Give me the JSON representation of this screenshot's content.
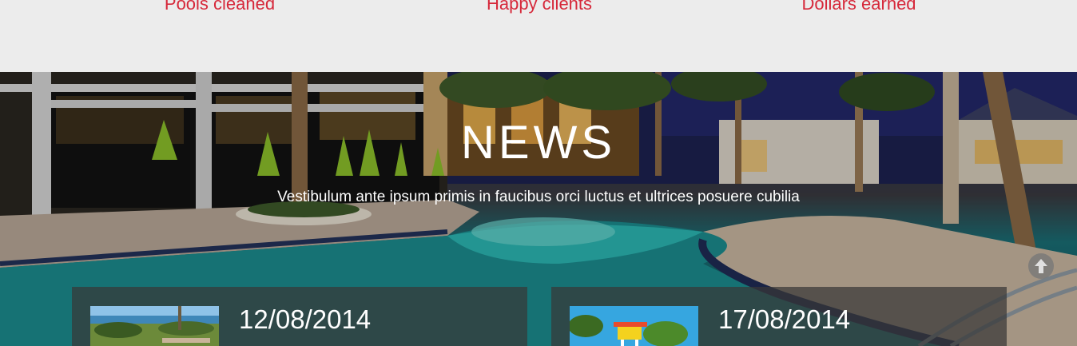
{
  "stats": [
    {
      "label": "Pools cleaned"
    },
    {
      "label": "Happy clients"
    },
    {
      "label": "Dollars earned"
    }
  ],
  "news": {
    "title": "NEWS",
    "subtitle": "Vestibulum ante ipsum primis in faucibus orci luctus et ultrices posuere cubilia",
    "cards": [
      {
        "date": "12/08/2014"
      },
      {
        "date": "17/08/2014"
      }
    ]
  },
  "icons": {
    "scroll_top": "arrow-up-circle-icon"
  },
  "colors": {
    "accent": "#d6283a",
    "card_bg": "#373737",
    "page_bg": "#ececec"
  }
}
